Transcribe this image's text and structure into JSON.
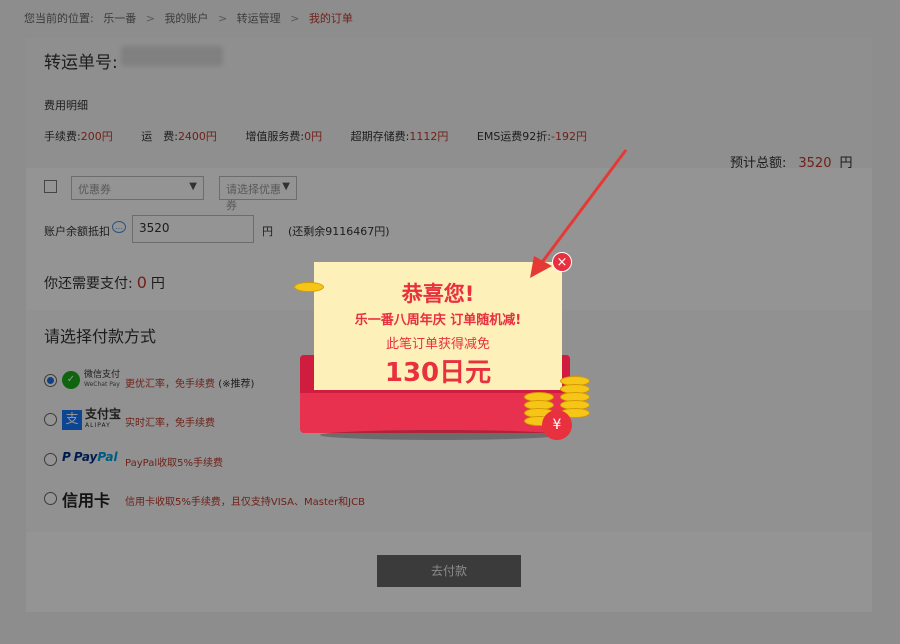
{
  "breadcrumb": {
    "prefix": "您当前的位置:",
    "items": [
      "乐一番",
      "我的账户",
      "转运管理",
      "我的订单"
    ],
    "sep": ">"
  },
  "order": {
    "title": "转运单号:",
    "fee_detail_label": "费用明细",
    "fees": [
      {
        "label": "手续费:",
        "value": "200円"
      },
      {
        "label": "运　费:",
        "value": "2400円"
      },
      {
        "label": "增值服务费:",
        "value": "0円"
      },
      {
        "label": "超期存储费:",
        "value": "1112円"
      },
      {
        "label": "EMS运费92折:",
        "value": "-192円"
      }
    ],
    "total_label": "预计总额:",
    "total_value": "3520",
    "total_unit": "円"
  },
  "coupon": {
    "select1": "优惠券",
    "select2": "请选择优惠券"
  },
  "balance": {
    "label": "账户余额抵扣",
    "input_value": "3520",
    "unit": "円",
    "remain": "(还剩余9116467円)"
  },
  "need_pay": {
    "label": "你还需要支付:",
    "value": "0",
    "unit": "円"
  },
  "payment": {
    "title": "请选择付款方式",
    "wechat": {
      "cn": "微信支付",
      "en": "WeChat Pay",
      "note": "更优汇率，免手续费",
      "note_extra": "(※推荐)"
    },
    "alipay": {
      "cn": "支付宝",
      "en": "ALIPAY",
      "note": "实时汇率，免手续费"
    },
    "paypal": {
      "p": "P",
      "pay": "Pay",
      "pal": "Pal",
      "note": "PayPal收取5%手续费"
    },
    "card": {
      "label": "信用卡",
      "note": "信用卡收取5%手续费，且仅支持VISA、Master和JCB"
    },
    "submit": "去付款"
  },
  "popup": {
    "line1": "恭喜您!",
    "line2": "乐一番八周年庆 订单随机减!",
    "line3": "此笔订单获得减免",
    "line4": "130日元",
    "close": "×",
    "bag_symbol": "¥"
  },
  "colors": {
    "accent_red": "#e8303f",
    "price_red": "#c0392b",
    "popup_paper": "#fdf0b9",
    "arrow_red": "#e53935"
  }
}
